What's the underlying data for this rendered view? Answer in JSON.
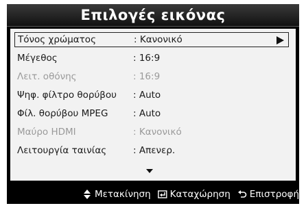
{
  "menu": {
    "title": "Επιλογές εικόνας",
    "items": [
      {
        "label": "Τόνος χρώματος",
        "value": ": Κανονικό",
        "state": "selected"
      },
      {
        "label": "Μέγεθος",
        "value": ": 16:9",
        "state": "normal"
      },
      {
        "label": "Λειτ. οθόνης",
        "value": ": 16:9",
        "state": "disabled"
      },
      {
        "label": "Ψηφ. φίλτρο θορύβου",
        "value": ": Auto",
        "state": "normal"
      },
      {
        "label": "Φίλ. θορύβου MPEG",
        "value": ": Auto",
        "state": "normal"
      },
      {
        "label": "Μαύρο HDMI",
        "value": ": Κανονικό",
        "state": "disabled"
      },
      {
        "label": "Λειτουργία ταινίας",
        "value": ": Απενερ.",
        "state": "normal"
      }
    ]
  },
  "footer": {
    "move_label": "Μετακίνηση",
    "enter_label": "Καταχώρηση",
    "return_label": "Επιστροφή",
    "move_icon": "up-down-arrows-icon",
    "enter_icon": "enter-icon",
    "return_icon": "return-icon"
  },
  "colors": {
    "panel_bg": "#000000",
    "list_bg": "#f2f2f2",
    "text": "#1a1a1a",
    "disabled_text": "#9a9a9a",
    "footer_text": "#ffffff"
  }
}
